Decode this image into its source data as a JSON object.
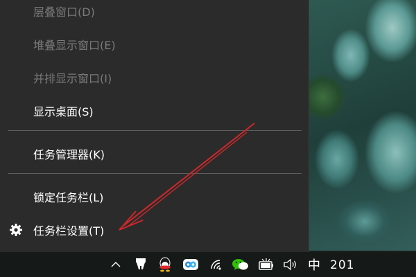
{
  "menu": {
    "items": [
      {
        "label": "层叠窗口(D)",
        "state": "disabled"
      },
      {
        "label": "堆叠显示窗口(E)",
        "state": "disabled"
      },
      {
        "label": "并排显示窗口(I)",
        "state": "disabled"
      },
      {
        "label": "显示桌面(S)",
        "state": "enabled"
      },
      {
        "label": "任务管理器(K)",
        "state": "enabled"
      },
      {
        "label": "锁定任务栏(L)",
        "state": "enabled"
      },
      {
        "label": "任务栏设置(T)",
        "state": "enabled",
        "icon": "gear-icon"
      }
    ]
  },
  "taskbar": {
    "ime_indicator": "中",
    "clock_text": "201",
    "tray_icons": [
      "chevron-up-icon",
      "pin-icon",
      "qq-penguin-icon",
      "cloud-app-icon",
      "wifi-icon",
      "wechat-icon",
      "battery-icon",
      "speaker-icon"
    ]
  },
  "annotation": {
    "arrow_color": "#d0282a"
  },
  "colors": {
    "menu_bg": "#2b2b2b",
    "enabled_text": "#ffffff",
    "disabled_text": "#7a7a7a",
    "separator": "#5e5e5e",
    "taskbar_bg": "#151a19"
  }
}
